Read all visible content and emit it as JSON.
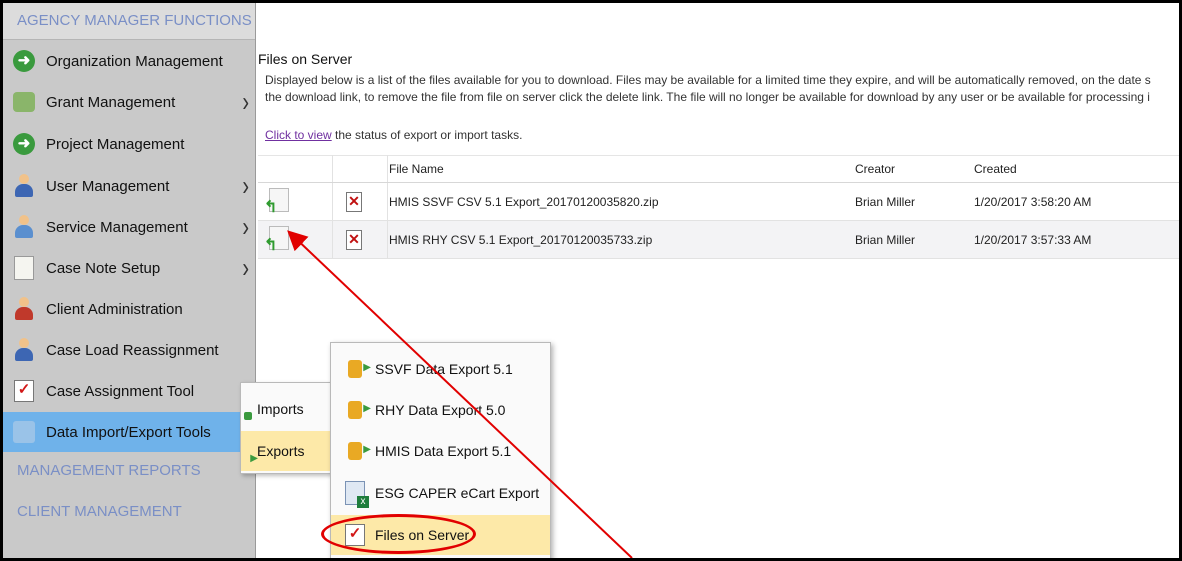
{
  "sidebar": {
    "header": "AGENCY MANAGER FUNCTIONS",
    "items": [
      {
        "label": "Organization Management",
        "icon": "arrow-circle-icon"
      },
      {
        "label": "Grant Management",
        "icon": "coins-icon"
      },
      {
        "label": "Project Management",
        "icon": "arrow-circle-icon"
      },
      {
        "label": "User Management",
        "icon": "user-icon"
      },
      {
        "label": "Service Management",
        "icon": "service-user-icon"
      },
      {
        "label": "Case Note Setup",
        "icon": "note-icon"
      },
      {
        "label": "Client Administration",
        "icon": "users-icon"
      },
      {
        "label": "Case Load Reassignment",
        "icon": "user-icon"
      },
      {
        "label": "Case Assignment Tool",
        "icon": "checklist-icon"
      },
      {
        "label": "Data Import/Export Tools",
        "icon": "tools-icon"
      }
    ],
    "section_reports": "MANAGEMENT REPORTS",
    "section_client": "CLIENT MANAGEMENT"
  },
  "main": {
    "title": "Files on Server",
    "desc_line1": "Displayed below is a list of the files available for you to download. Files may be available for a limited time they expire, and will be automatically removed, on the date s",
    "desc_line2": "the download link, to remove the file from file on server click the delete link. The file will no longer be available for download by any user or be available for processing i",
    "link_text": "Click to view",
    "link_suffix": " the status of export or import tasks.",
    "table": {
      "headers": [
        "",
        "",
        "File Name",
        "Creator",
        "Created"
      ],
      "rows": [
        {
          "file": "HMIS SSVF CSV 5.1 Export_20170120035820.zip",
          "creator": "Brian Miller",
          "created": "1/20/2017 3:58:20 AM"
        },
        {
          "file": "HMIS RHY CSV 5.1 Export_20170120035733.zip",
          "creator": "Brian Miller",
          "created": "1/20/2017 3:57:33 AM"
        }
      ]
    }
  },
  "flyout_io": {
    "imports": "Imports",
    "exports": "Exports"
  },
  "flyout_exports": {
    "items": [
      "SSVF Data Export 5.1",
      "RHY Data Export 5.0",
      "HMIS Data Export 5.1",
      "ESG CAPER eCart Export",
      "Files on Server"
    ]
  },
  "colors": {
    "sidebar_bg": "#c9c9c9",
    "selected_bg": "#6fb2ea",
    "highlight_bg": "#fde9a8",
    "annotation_red": "#e10000"
  }
}
